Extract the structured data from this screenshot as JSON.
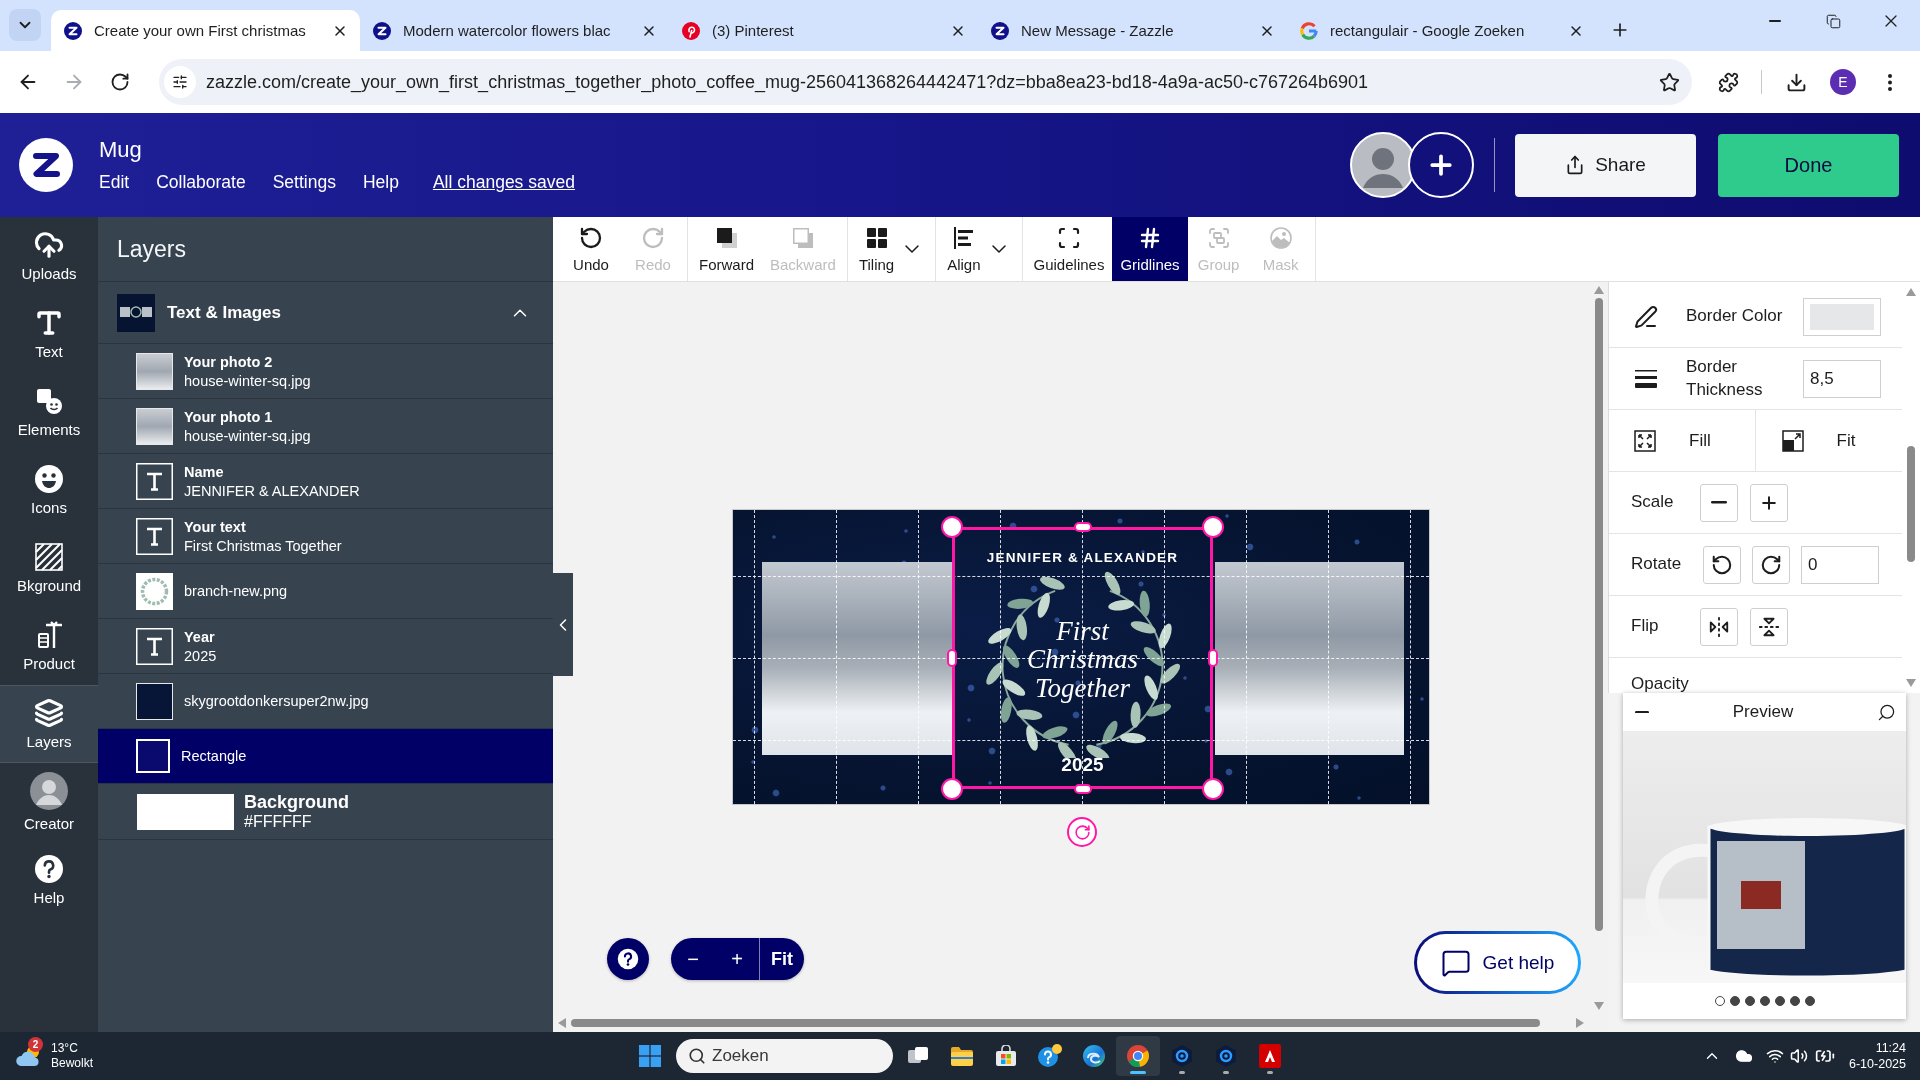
{
  "browser": {
    "tabs": [
      {
        "kind": "zazzle",
        "title": "Create your own First christmas",
        "selected": true
      },
      {
        "kind": "zazzle",
        "title": "Modern watercolor flowers blac",
        "selected": false
      },
      {
        "kind": "pinterest",
        "title": "(3) Pinterest",
        "selected": false
      },
      {
        "kind": "zazzle",
        "title": "New Message - Zazzle",
        "selected": false
      },
      {
        "kind": "google",
        "title": "rectangulair - Google Zoeken",
        "selected": false
      }
    ],
    "url": "zazzle.com/create_your_own_first_christmas_together_photo_coffee_mug-256041368264442471?dz=bba8ea23-bd18-4a9a-ac50-c767264b6901",
    "forward_disabled": true,
    "profile_initial": "E"
  },
  "app_header": {
    "title": "Mug",
    "menu": [
      "Edit",
      "Collaborate",
      "Settings",
      "Help"
    ],
    "save_status": "All changes saved",
    "share": "Share",
    "done": "Done"
  },
  "rail": [
    {
      "kind": "uploads",
      "label": "Uploads",
      "selected": false
    },
    {
      "kind": "text",
      "label": "Text",
      "selected": false
    },
    {
      "kind": "elements",
      "label": "Elements",
      "selected": false
    },
    {
      "kind": "icons",
      "label": "Icons",
      "selected": false
    },
    {
      "kind": "background",
      "label": "Bkground",
      "selected": false
    },
    {
      "kind": "product",
      "label": "Product",
      "selected": false
    },
    {
      "kind": "layers",
      "label": "Layers",
      "selected": true
    },
    {
      "kind": "creator",
      "label": "Creator",
      "selected": false
    },
    {
      "kind": "help",
      "label": "Help",
      "selected": false
    }
  ],
  "layers_panel": {
    "title": "Layers",
    "group": {
      "title": "Text & Images",
      "expanded": true,
      "items": [
        {
          "kind": "photo",
          "title": "Your photo 2",
          "subtitle": "house-winter-sq.jpg",
          "selected": false
        },
        {
          "kind": "photo",
          "title": "Your photo 1",
          "subtitle": "house-winter-sq.jpg",
          "selected": false
        },
        {
          "kind": "text",
          "title": "Name",
          "subtitle": "JENNIFER & ALEXANDER",
          "selected": false
        },
        {
          "kind": "text",
          "title": "Your text",
          "subtitle": "First Christmas Together",
          "selected": false
        },
        {
          "kind": "graphic",
          "title": "branch-new.png",
          "selected": false
        },
        {
          "kind": "text",
          "title": "Year",
          "subtitle": "2025",
          "selected": false
        },
        {
          "kind": "backdrop",
          "title": "skygrootdonkersuper2nw.jpg",
          "selected": false
        },
        {
          "kind": "shape",
          "title": "Rectangle",
          "selected": true
        }
      ]
    },
    "background": {
      "title": "Background",
      "value": "#FFFFFF"
    }
  },
  "toolbar": {
    "groups": [
      {
        "items": [
          {
            "kind": "undo",
            "label": "Undo",
            "disabled": false,
            "selected": false,
            "dropdown": false
          },
          {
            "kind": "redo",
            "label": "Redo",
            "disabled": true,
            "selected": false,
            "dropdown": false
          }
        ]
      },
      {
        "items": [
          {
            "kind": "forward",
            "label": "Forward",
            "disabled": false,
            "selected": false,
            "dropdown": false
          },
          {
            "kind": "backward",
            "label": "Backward",
            "disabled": true,
            "selected": false,
            "dropdown": false
          }
        ]
      },
      {
        "items": [
          {
            "kind": "tiling",
            "label": "Tiling",
            "disabled": false,
            "selected": false,
            "dropdown": true
          }
        ]
      },
      {
        "items": [
          {
            "kind": "align",
            "label": "Align",
            "disabled": false,
            "selected": false,
            "dropdown": true
          }
        ]
      },
      {
        "items": [
          {
            "kind": "guidelines",
            "label": "Guidelines",
            "disabled": false,
            "selected": false,
            "dropdown": false
          },
          {
            "kind": "gridlines",
            "label": "Gridlines",
            "disabled": false,
            "selected": true,
            "dropdown": false
          },
          {
            "kind": "group",
            "label": "Group",
            "disabled": true,
            "selected": false,
            "dropdown": false
          },
          {
            "kind": "mask",
            "label": "Mask",
            "disabled": true,
            "selected": false,
            "dropdown": false
          }
        ]
      }
    ]
  },
  "design": {
    "names": "JENNIFER & ALEXANDER",
    "script": "First Christmas Together",
    "year": "2025"
  },
  "zoom_controls": {
    "zoom_out": "−",
    "zoom_in": "+",
    "fit": "Fit"
  },
  "get_help": "Get help",
  "properties": {
    "border_color": {
      "label": "Border Color",
      "color": "#e6e7e9"
    },
    "border_thickness": {
      "label": "Border Thickness",
      "value": "8,5"
    },
    "fill_label": "Fill",
    "fit_label": "Fit",
    "scale_label": "Scale",
    "rotate": {
      "label": "Rotate",
      "value": "0"
    },
    "flip_label": "Flip",
    "opacity_label": "Opacity"
  },
  "preview": {
    "title": "Preview",
    "pages": [
      {
        "selected": true
      },
      {
        "selected": false
      },
      {
        "selected": false
      },
      {
        "selected": false
      },
      {
        "selected": false
      },
      {
        "selected": false
      },
      {
        "selected": false
      }
    ]
  },
  "taskbar": {
    "weather": {
      "badge": "2",
      "temperature": "13°C",
      "condition": "Bewolkt"
    },
    "search": {
      "placeholder": "Zoeken"
    },
    "apps": [
      {
        "kind": "task_view",
        "running": false,
        "selected": false
      },
      {
        "kind": "explorer",
        "running": false,
        "selected": false
      },
      {
        "kind": "store",
        "running": false,
        "selected": false
      },
      {
        "kind": "tips",
        "running": false,
        "selected": false
      },
      {
        "kind": "edge",
        "running": false,
        "selected": false
      },
      {
        "kind": "chrome",
        "running": true,
        "selected": true
      },
      {
        "kind": "blue_app",
        "running": true,
        "selected": false
      },
      {
        "kind": "blue_app",
        "running": true,
        "selected": false
      },
      {
        "kind": "adobe",
        "running": true,
        "selected": false
      }
    ],
    "time": "11:24",
    "date": "6-10-2025"
  }
}
